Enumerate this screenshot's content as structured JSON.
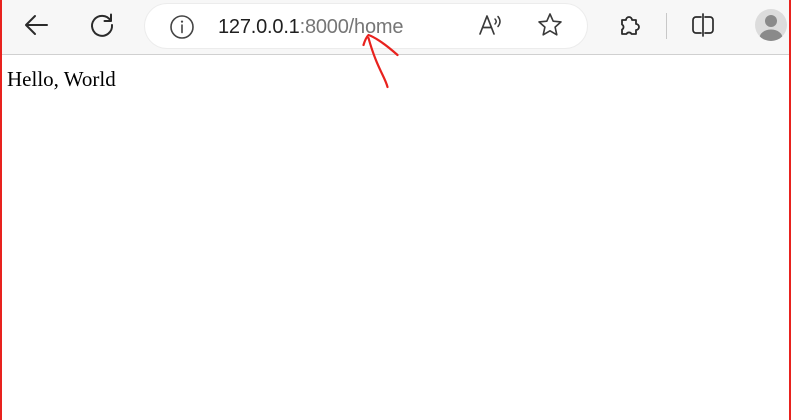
{
  "browser": {
    "address_bar": {
      "url_host": "127.0.0.1",
      "url_path": ":8000/home"
    },
    "icons": {
      "back": "back-arrow-icon",
      "refresh": "refresh-icon",
      "info": "info-icon",
      "read_aloud": "read-aloud-icon",
      "favorite": "star-icon",
      "extensions": "puzzle-icon",
      "split_screen": "split-screen-icon",
      "profile": "profile-avatar-icon"
    }
  },
  "page": {
    "body_text": "Hello, World"
  },
  "annotation": {
    "color": "#e8221e",
    "type": "hand-drawn-arrow"
  },
  "colors": {
    "frame_border": "#e8221e",
    "toolbar_bg": "#f7f7f7",
    "url_host": "#1f1f1f",
    "url_path": "#767676"
  }
}
